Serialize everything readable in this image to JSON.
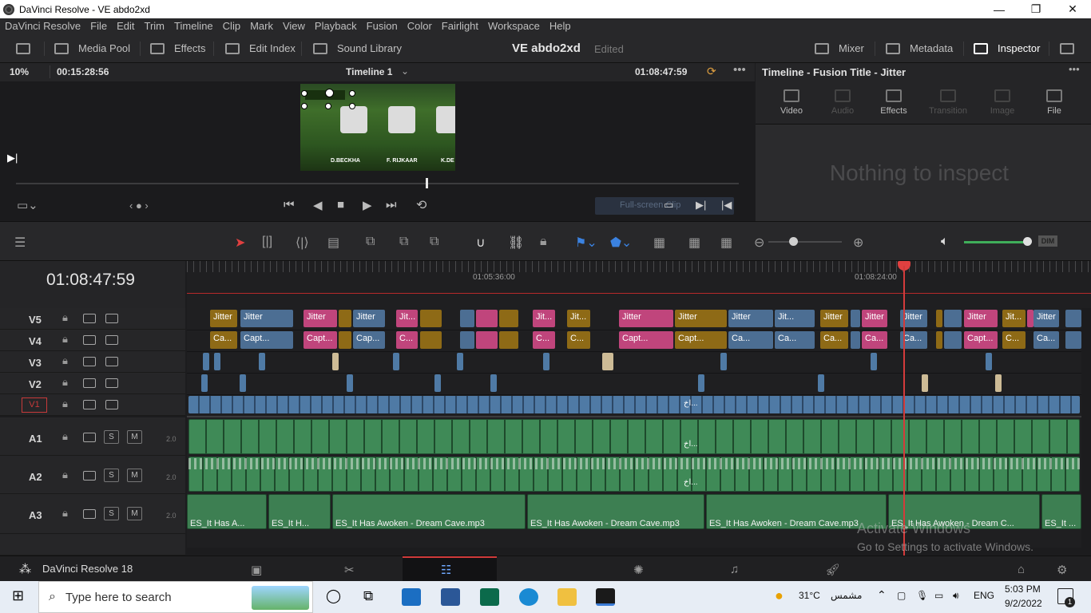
{
  "window": {
    "title": "DaVinci Resolve - VE abdo2xd",
    "minimize": "—",
    "maximize": "❐",
    "close": "✕"
  },
  "menu": [
    "DaVinci Resolve",
    "File",
    "Edit",
    "Trim",
    "Timeline",
    "Clip",
    "Mark",
    "View",
    "Playback",
    "Fusion",
    "Color",
    "Fairlight",
    "Workspace",
    "Help"
  ],
  "toolbar": {
    "media_pool": "Media Pool",
    "effects": "Effects",
    "edit_index": "Edit Index",
    "sound_library": "Sound Library",
    "project_name": "VE abdo2xd",
    "project_status": "Edited",
    "mixer": "Mixer",
    "metadata": "Metadata",
    "inspector": "Inspector"
  },
  "viewer": {
    "zoom": "10%",
    "duration": "00:15:28:56",
    "timeline_name": "Timeline 1",
    "timecode": "01:08:47:59",
    "names": [
      "D.BECKHA",
      "F. RIJKAAR",
      "K.DE"
    ],
    "fullscreen_label": "Full-screen Clip"
  },
  "inspector_panel": {
    "title": "Timeline - Fusion Title - Jitter",
    "tabs": [
      "Video",
      "Audio",
      "Effects",
      "Transition",
      "Image",
      "File"
    ],
    "empty_message": "Nothing to inspect"
  },
  "timeline": {
    "timecode": "01:08:47:59",
    "ruler_labels": [
      "01:05:36:00",
      "01:08:24:00"
    ],
    "video_tracks": [
      "V5",
      "V4",
      "V3",
      "V2",
      "V1"
    ],
    "audio_tracks": [
      "A1",
      "A2",
      "A3"
    ],
    "audio_level": "2.0",
    "solo": "S",
    "mute": "M",
    "v5_clips": [
      "Jitter",
      "Jitter",
      "Jitter",
      "Jitter",
      "Jit...",
      "Jit...",
      "Jit...",
      "Jitter",
      "Jitter",
      "Jitter",
      "Jit...",
      "Jitter",
      "Jitter",
      "Jitter",
      "Jitter",
      "Jit...",
      "Jitter"
    ],
    "v4_clips": [
      "Ca...",
      "Capt...",
      "Capt...",
      "Cap...",
      "C...",
      "C...",
      "C...",
      "Capt...",
      "Capt...",
      "Ca...",
      "Ca...",
      "Ca...",
      "Ca...",
      "Ca...",
      "Capt...",
      "C...",
      "Ca..."
    ],
    "v1_label": "اخ...",
    "a1_label": "اخ...",
    "a2_label": "اخ...",
    "a3_clips": [
      "ES_It Has A...",
      "ES_It H...",
      "ES_It Has Awoken - Dream Cave.mp3",
      "ES_It Has Awoken - Dream Cave.mp3",
      "ES_It Has Awoken - Dream Cave.mp3",
      "ES_It Has Awoken - Dream C...",
      "ES_It ..."
    ]
  },
  "overlay": {
    "activate_title": "Activate Windows",
    "activate_sub": "Go to Settings to activate Windows."
  },
  "pagebar": {
    "app_name": "DaVinci Resolve 18"
  },
  "taskbar": {
    "search_placeholder": "Type here to search",
    "temperature": "31°C",
    "weather": "مشمس",
    "language": "ENG",
    "time": "5:03 PM",
    "date": "9/2/2022",
    "notifications": "1"
  }
}
